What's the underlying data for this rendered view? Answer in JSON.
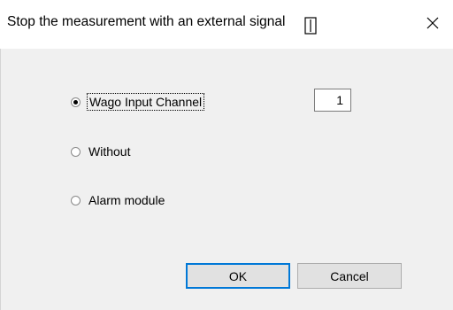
{
  "window": {
    "title": "Stop the measurement with an external signal",
    "close_label": "✕"
  },
  "options": [
    {
      "label": "Wago Input Channel",
      "checked": true
    },
    {
      "label": "Without",
      "checked": false
    },
    {
      "label": "Alarm module",
      "checked": false
    }
  ],
  "channel_input": {
    "value": "1"
  },
  "buttons": {
    "ok_label": "OK",
    "cancel_label": "Cancel"
  }
}
